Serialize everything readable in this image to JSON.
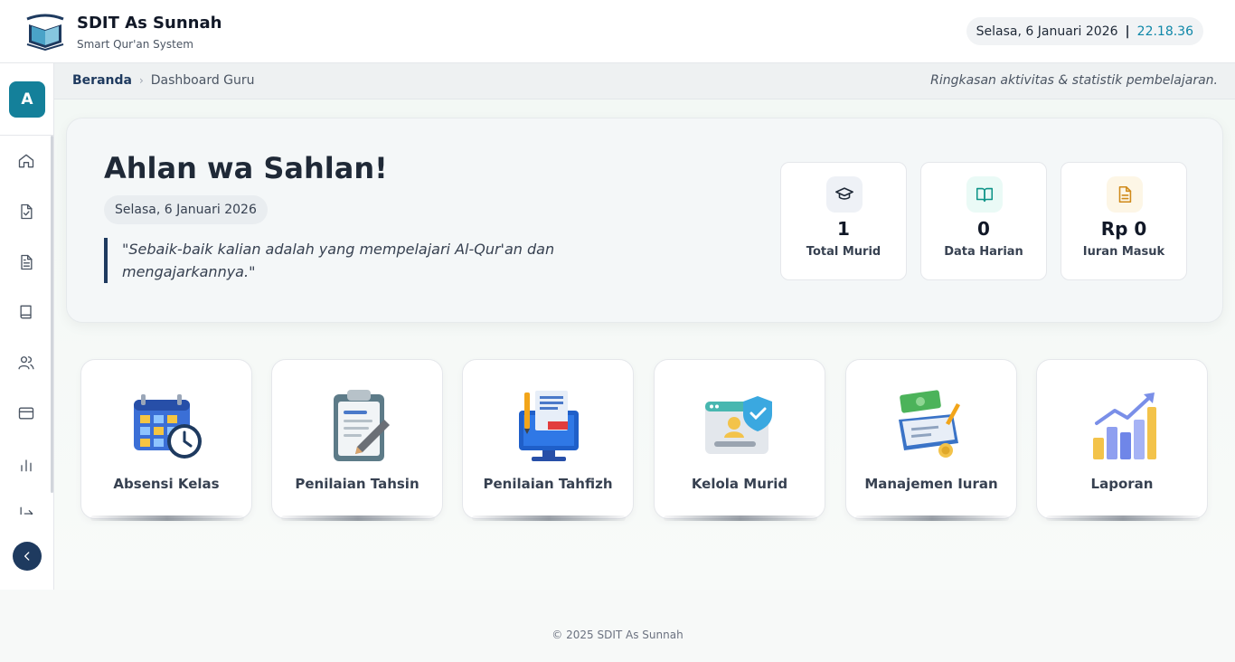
{
  "header": {
    "title": "SDIT As Sunnah",
    "subtitle": "Smart Qur'an System",
    "date": "Selasa, 6 Januari 2026",
    "separator": "|",
    "time": "22.18.36"
  },
  "sidebar": {
    "avatar": "A",
    "items": [
      "home-icon",
      "file-check-icon",
      "document-icon",
      "book-icon",
      "users-icon",
      "card-icon",
      "chart-icon",
      "logout-icon"
    ]
  },
  "breadcrumb": {
    "home": "Beranda",
    "current": "Dashboard Guru",
    "description": "Ringkasan aktivitas & statistik pembelajaran."
  },
  "hero": {
    "title": "Ahlan wa Sahlan!",
    "date": "Selasa, 6 Januari 2026",
    "quote": "\"Sebaik-baik kalian adalah yang mempelajari Al-Qur'an dan mengajarkannya.\""
  },
  "stats": [
    {
      "icon": "graduation-cap-icon",
      "value": "1",
      "label": "Total Murid"
    },
    {
      "icon": "open-book-icon",
      "value": "0",
      "label": "Data Harian"
    },
    {
      "icon": "receipt-icon",
      "value": "Rp 0",
      "label": "Iuran Masuk"
    }
  ],
  "menu": [
    {
      "icon": "calendar-clock-icon",
      "label": "Absensi Kelas"
    },
    {
      "icon": "clipboard-icon",
      "label": "Penilaian Tahsin"
    },
    {
      "icon": "monitor-document-icon",
      "label": "Penilaian Tahfizh"
    },
    {
      "icon": "user-browser-icon",
      "label": "Kelola Murid"
    },
    {
      "icon": "money-check-icon",
      "label": "Manajemen Iuran"
    },
    {
      "icon": "bar-chart-icon",
      "label": "Laporan"
    }
  ],
  "colors": {
    "primary": "#1e3a5f",
    "accent": "#14809a",
    "time": "#0e87a8"
  },
  "footer": "© 2025 SDIT As Sunnah"
}
